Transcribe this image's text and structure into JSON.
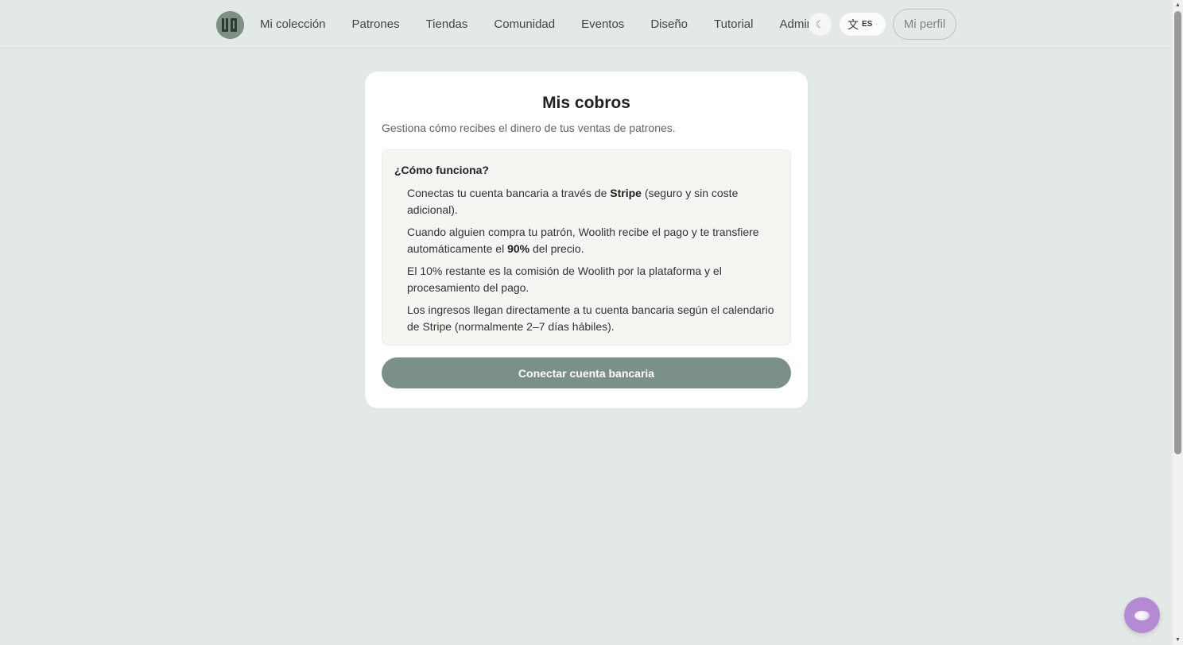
{
  "nav": {
    "logo_text": "W",
    "items": [
      {
        "label": "Mi colección"
      },
      {
        "label": "Patrones"
      },
      {
        "label": "Tiendas"
      },
      {
        "label": "Comunidad"
      },
      {
        "label": "Eventos"
      },
      {
        "label": "Diseño"
      },
      {
        "label": "Tutorial"
      },
      {
        "label": "Admin"
      }
    ],
    "theme_icon": "☾",
    "language_glyph": "文",
    "language_code": "ES",
    "language_caret": "·",
    "profile_label": "Mi perfil"
  },
  "card": {
    "title": "Mis cobros",
    "subtitle": "Gestiona cómo recibes el dinero de tus ventas de patrones.",
    "info_title": "¿Cómo funciona?",
    "steps": [
      {
        "before": "Conectas tu cuenta bancaria a través de ",
        "bold": "Stripe",
        "after": " (seguro y sin coste adicional)."
      },
      {
        "before": "Cuando alguien compra tu patrón, Woolith recibe el pago y te transfiere automáticamente el ",
        "bold": "90%",
        "after": " del precio."
      },
      {
        "before": "El 10% restante es la comisión de Woolith por la plataforma y el procesamiento del pago.",
        "bold": "",
        "after": ""
      },
      {
        "before": "Los ingresos llegan directamente a tu cuenta bancaria según el calendario de Stripe (normalmente 2–7 días hábiles).",
        "bold": "",
        "after": ""
      }
    ],
    "cta_label": "Conectar cuenta bancaria"
  },
  "colors": {
    "background": "#e3e9e6",
    "accent": "#7b9187",
    "chat_bubble": "#b58ad4"
  },
  "icons": {
    "logo": "woolith-logo",
    "theme": "moon-icon",
    "language": "translate-icon",
    "chat": "chat-bubble-icon"
  }
}
